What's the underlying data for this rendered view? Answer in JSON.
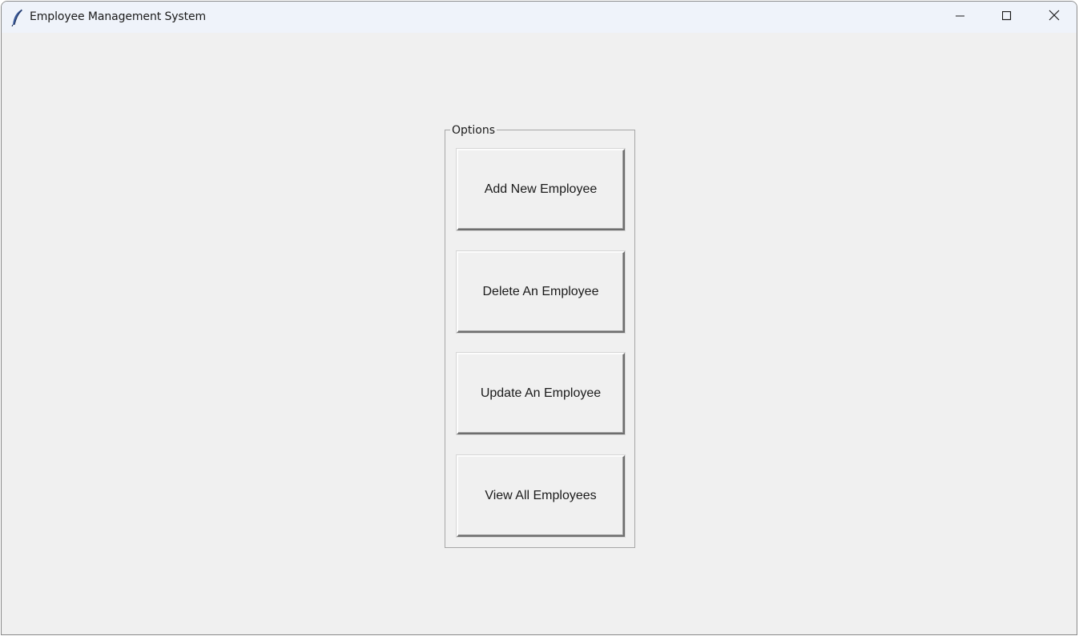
{
  "window": {
    "title": "Employee Management System",
    "app_icon": "feather-icon",
    "controls": {
      "minimize_icon": "minimize-icon",
      "maximize_icon": "maximize-icon",
      "close_icon": "close-icon"
    }
  },
  "options": {
    "label": "Options",
    "buttons": [
      {
        "label": "Add New Employee"
      },
      {
        "label": "Delete An Employee"
      },
      {
        "label": "Update An Employee"
      },
      {
        "label": "View All Employees"
      }
    ]
  }
}
